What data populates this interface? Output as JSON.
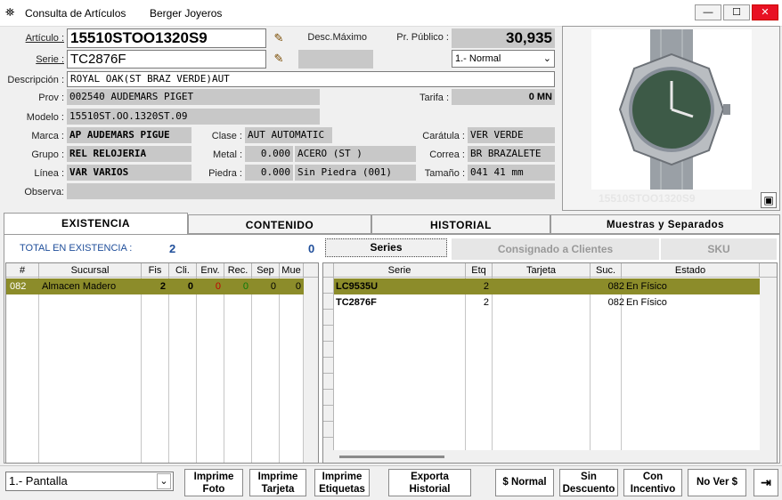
{
  "window": {
    "title": "Consulta de Artículos",
    "company": "Berger Joyeros",
    "min": "—",
    "max": "☐",
    "close": "✕"
  },
  "fields": {
    "articulo_label": "Artículo :",
    "articulo": "15510STOO1320S9",
    "serie_label": "Serie :",
    "serie": "TC2876F",
    "desc_maximo_label": "Desc.Máximo",
    "pr_publico_label": "Pr. Público :",
    "pr_publico": "30,935",
    "price_list": "1.- Normal",
    "descripcion_label": "Descripción :",
    "descripcion": "ROYAL OAK(ST BRAZ VERDE)AUT",
    "prov_label": "Prov :",
    "prov": "002540  AUDEMARS PIGET",
    "tarifa_label": "Tarifa :",
    "tarifa": "0 MN",
    "modelo_label": "Modelo :",
    "modelo": "15510ST.OO.1320ST.09",
    "marca_label": "Marca :",
    "marca": "AP   AUDEMARS PIGUE",
    "clase_label": "Clase :",
    "clase": "AUT  AUTOMATIC",
    "caratula_label": "Carátula :",
    "caratula": "VER  VERDE",
    "grupo_label": "Grupo :",
    "grupo": "REL  RELOJERIA",
    "metal_label": "Metal :",
    "metal_num": "0.000",
    "metal": "ACERO (ST )",
    "correa_label": "Correa :",
    "correa": "BR   BRAZALETE",
    "linea_label": "Línea :",
    "linea": "VAR  VARIOS",
    "piedra_label": "Piedra :",
    "piedra_num": "0.000",
    "piedra": "Sin Piedra (001)",
    "tamano_label": "Tamaño :",
    "tamano": "041  41 mm",
    "observa_label": "Observa:",
    "observa": ""
  },
  "photo": {
    "caption": "15510STOO1320S9"
  },
  "tabs": [
    "EXISTENCIA",
    "CONTENIDO",
    "HISTORIAL",
    "Muestras y Separados"
  ],
  "existencia": {
    "total_label": "TOTAL EN EXISTENCIA :",
    "total": "2",
    "total2": "0",
    "columns": [
      "#",
      "Sucursal",
      "Fis",
      "Cli.",
      "Env.",
      "Rec.",
      "Sep",
      "Mue"
    ],
    "rows": [
      {
        "num": "082",
        "sucursal": "Almacen Madero",
        "fis": "2",
        "cli": "0",
        "env": "0",
        "rec": "0",
        "sep": "0",
        "mue": "0"
      }
    ]
  },
  "subtabs": [
    "Series",
    "Consignado a Clientes",
    "SKU"
  ],
  "series": {
    "columns": [
      "Serie",
      "Etq",
      "Tarjeta",
      "Suc.",
      "Estado"
    ],
    "rows": [
      {
        "serie": "LC9535U",
        "etq": "2",
        "tarjeta": "",
        "suc": "082",
        "estado": "En Físico"
      },
      {
        "serie": "TC2876F",
        "etq": "2",
        "tarjeta": "",
        "suc": "082",
        "estado": "En Físico"
      }
    ]
  },
  "bottom": {
    "output": "1.- Pantalla",
    "buttons": [
      "Imprime\nFoto",
      "Imprime\nTarjeta",
      "Imprime\nEtiquetas",
      "Exporta\nHistorial",
      "$ Normal",
      "Sin\nDescuento",
      "Con\nIncentivo",
      "No Ver $"
    ]
  },
  "colors": {
    "selected_row": "#8c8c2a",
    "field_bg": "#c8c8c8",
    "accent_blue": "#1f4e9a"
  }
}
